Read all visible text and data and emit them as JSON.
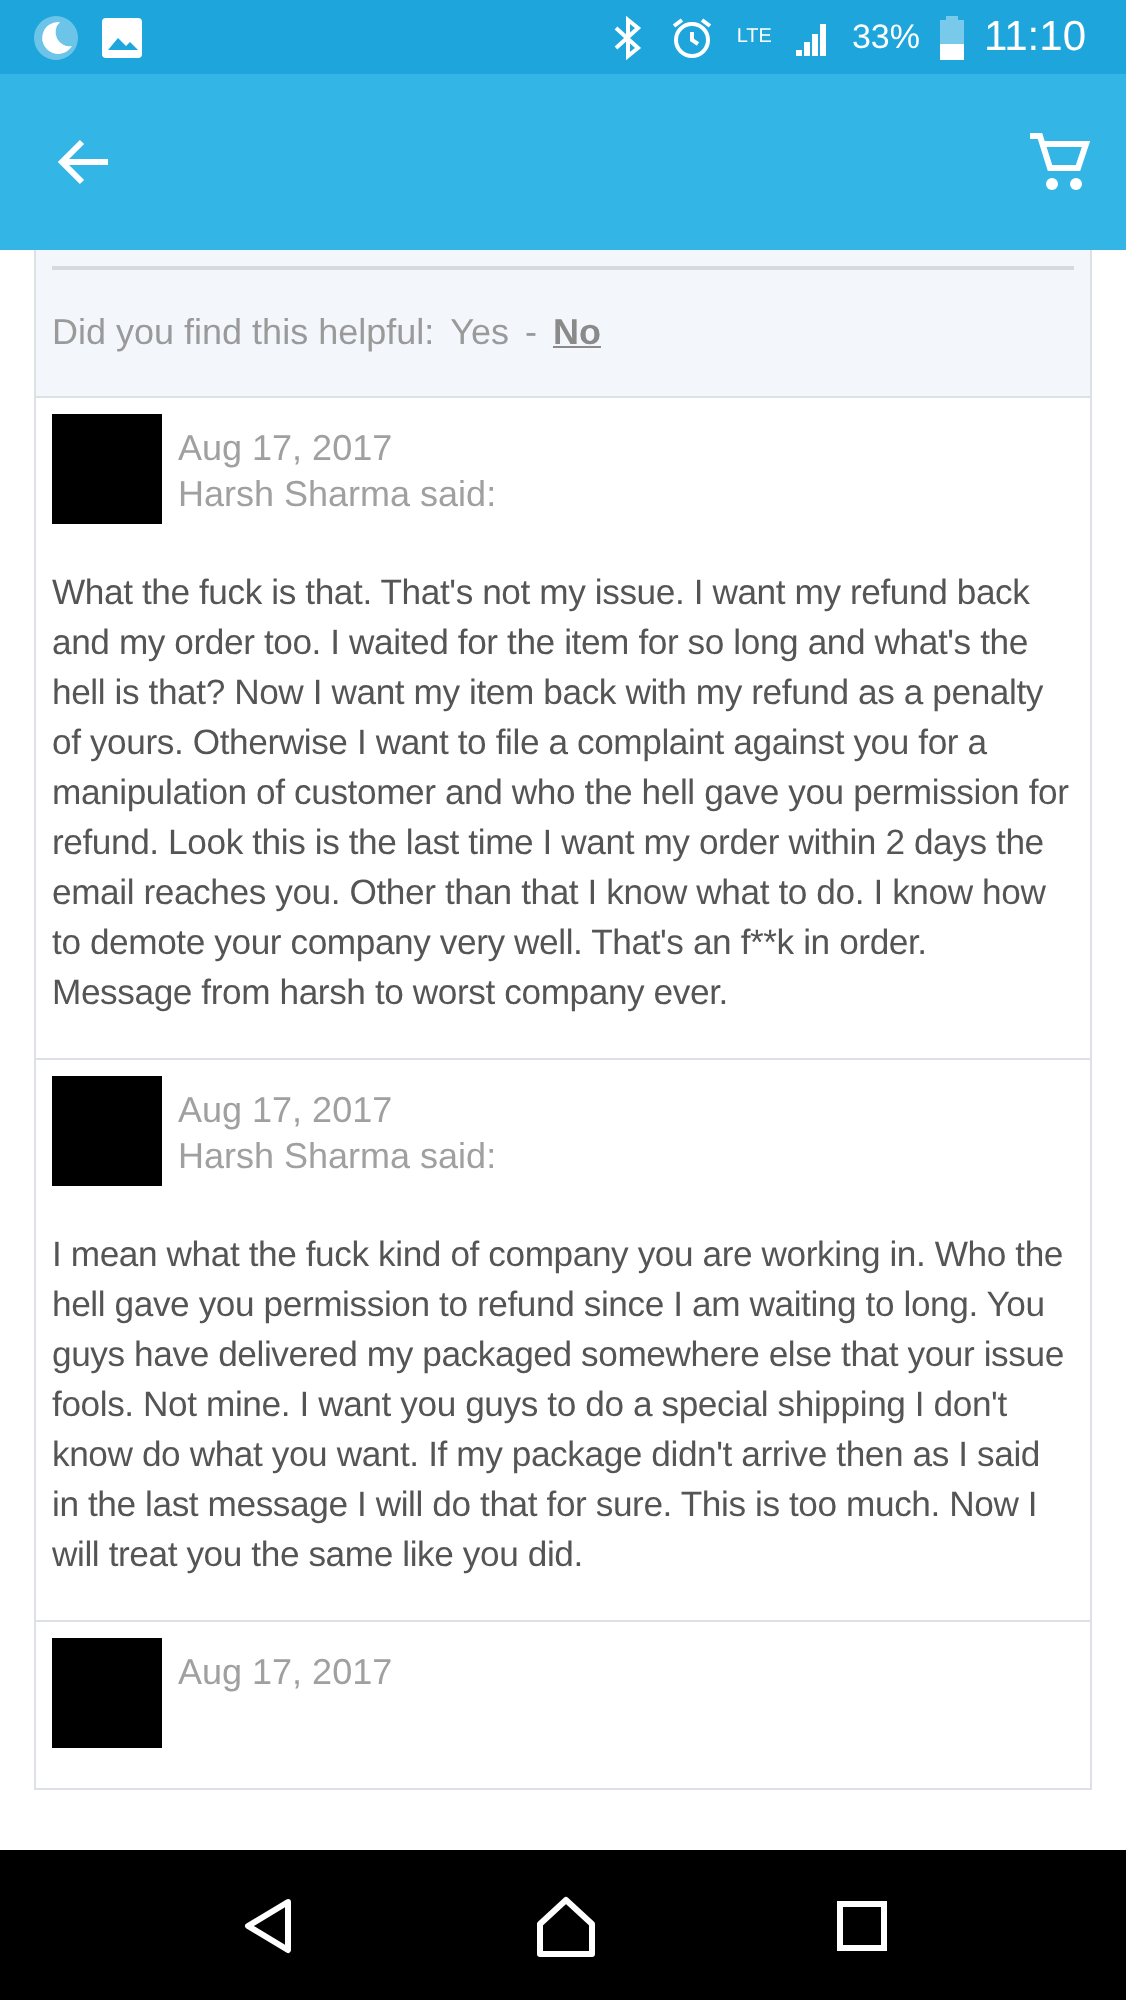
{
  "status_bar": {
    "network": "LTE",
    "battery": "33%",
    "time": "11:10"
  },
  "helpful": {
    "question": "Did you find this helpful:",
    "separator": "-",
    "options": [
      {
        "label": "Yes",
        "selected": false
      },
      {
        "label": "No",
        "selected": true
      }
    ]
  },
  "comments": [
    {
      "date": "Aug 17, 2017",
      "author": "Harsh Sharma said:",
      "text": "What the fuck is that. That's not my issue. I want my refund back and my order too. I waited for the item for so long and what's the hell is that? Now I want my item back with my refund as a penalty of yours. Otherwise I want to file a complaint against you for a manipulation of customer and who the hell gave you permission for refund. Look this is the last time I want my order within 2 days the email reaches you. Other than that I know what to do. I know how to demote your company very well. That's an f**k in order. Message from harsh to worst company ever."
    },
    {
      "date": "Aug 17, 2017",
      "author": "Harsh Sharma said:",
      "text": "I mean what the fuck kind of company you are working in. Who the hell gave you permission to refund since I am waiting to long. You guys have delivered my packaged somewhere else that your issue fools. Not mine. I want you guys to do a special shipping I don't know do what you want. If my package didn't arrive then as I said in the last message I will do that for sure. This is too much. Now I will treat you the same like you did."
    },
    {
      "date": "Aug 17, 2017"
    }
  ]
}
